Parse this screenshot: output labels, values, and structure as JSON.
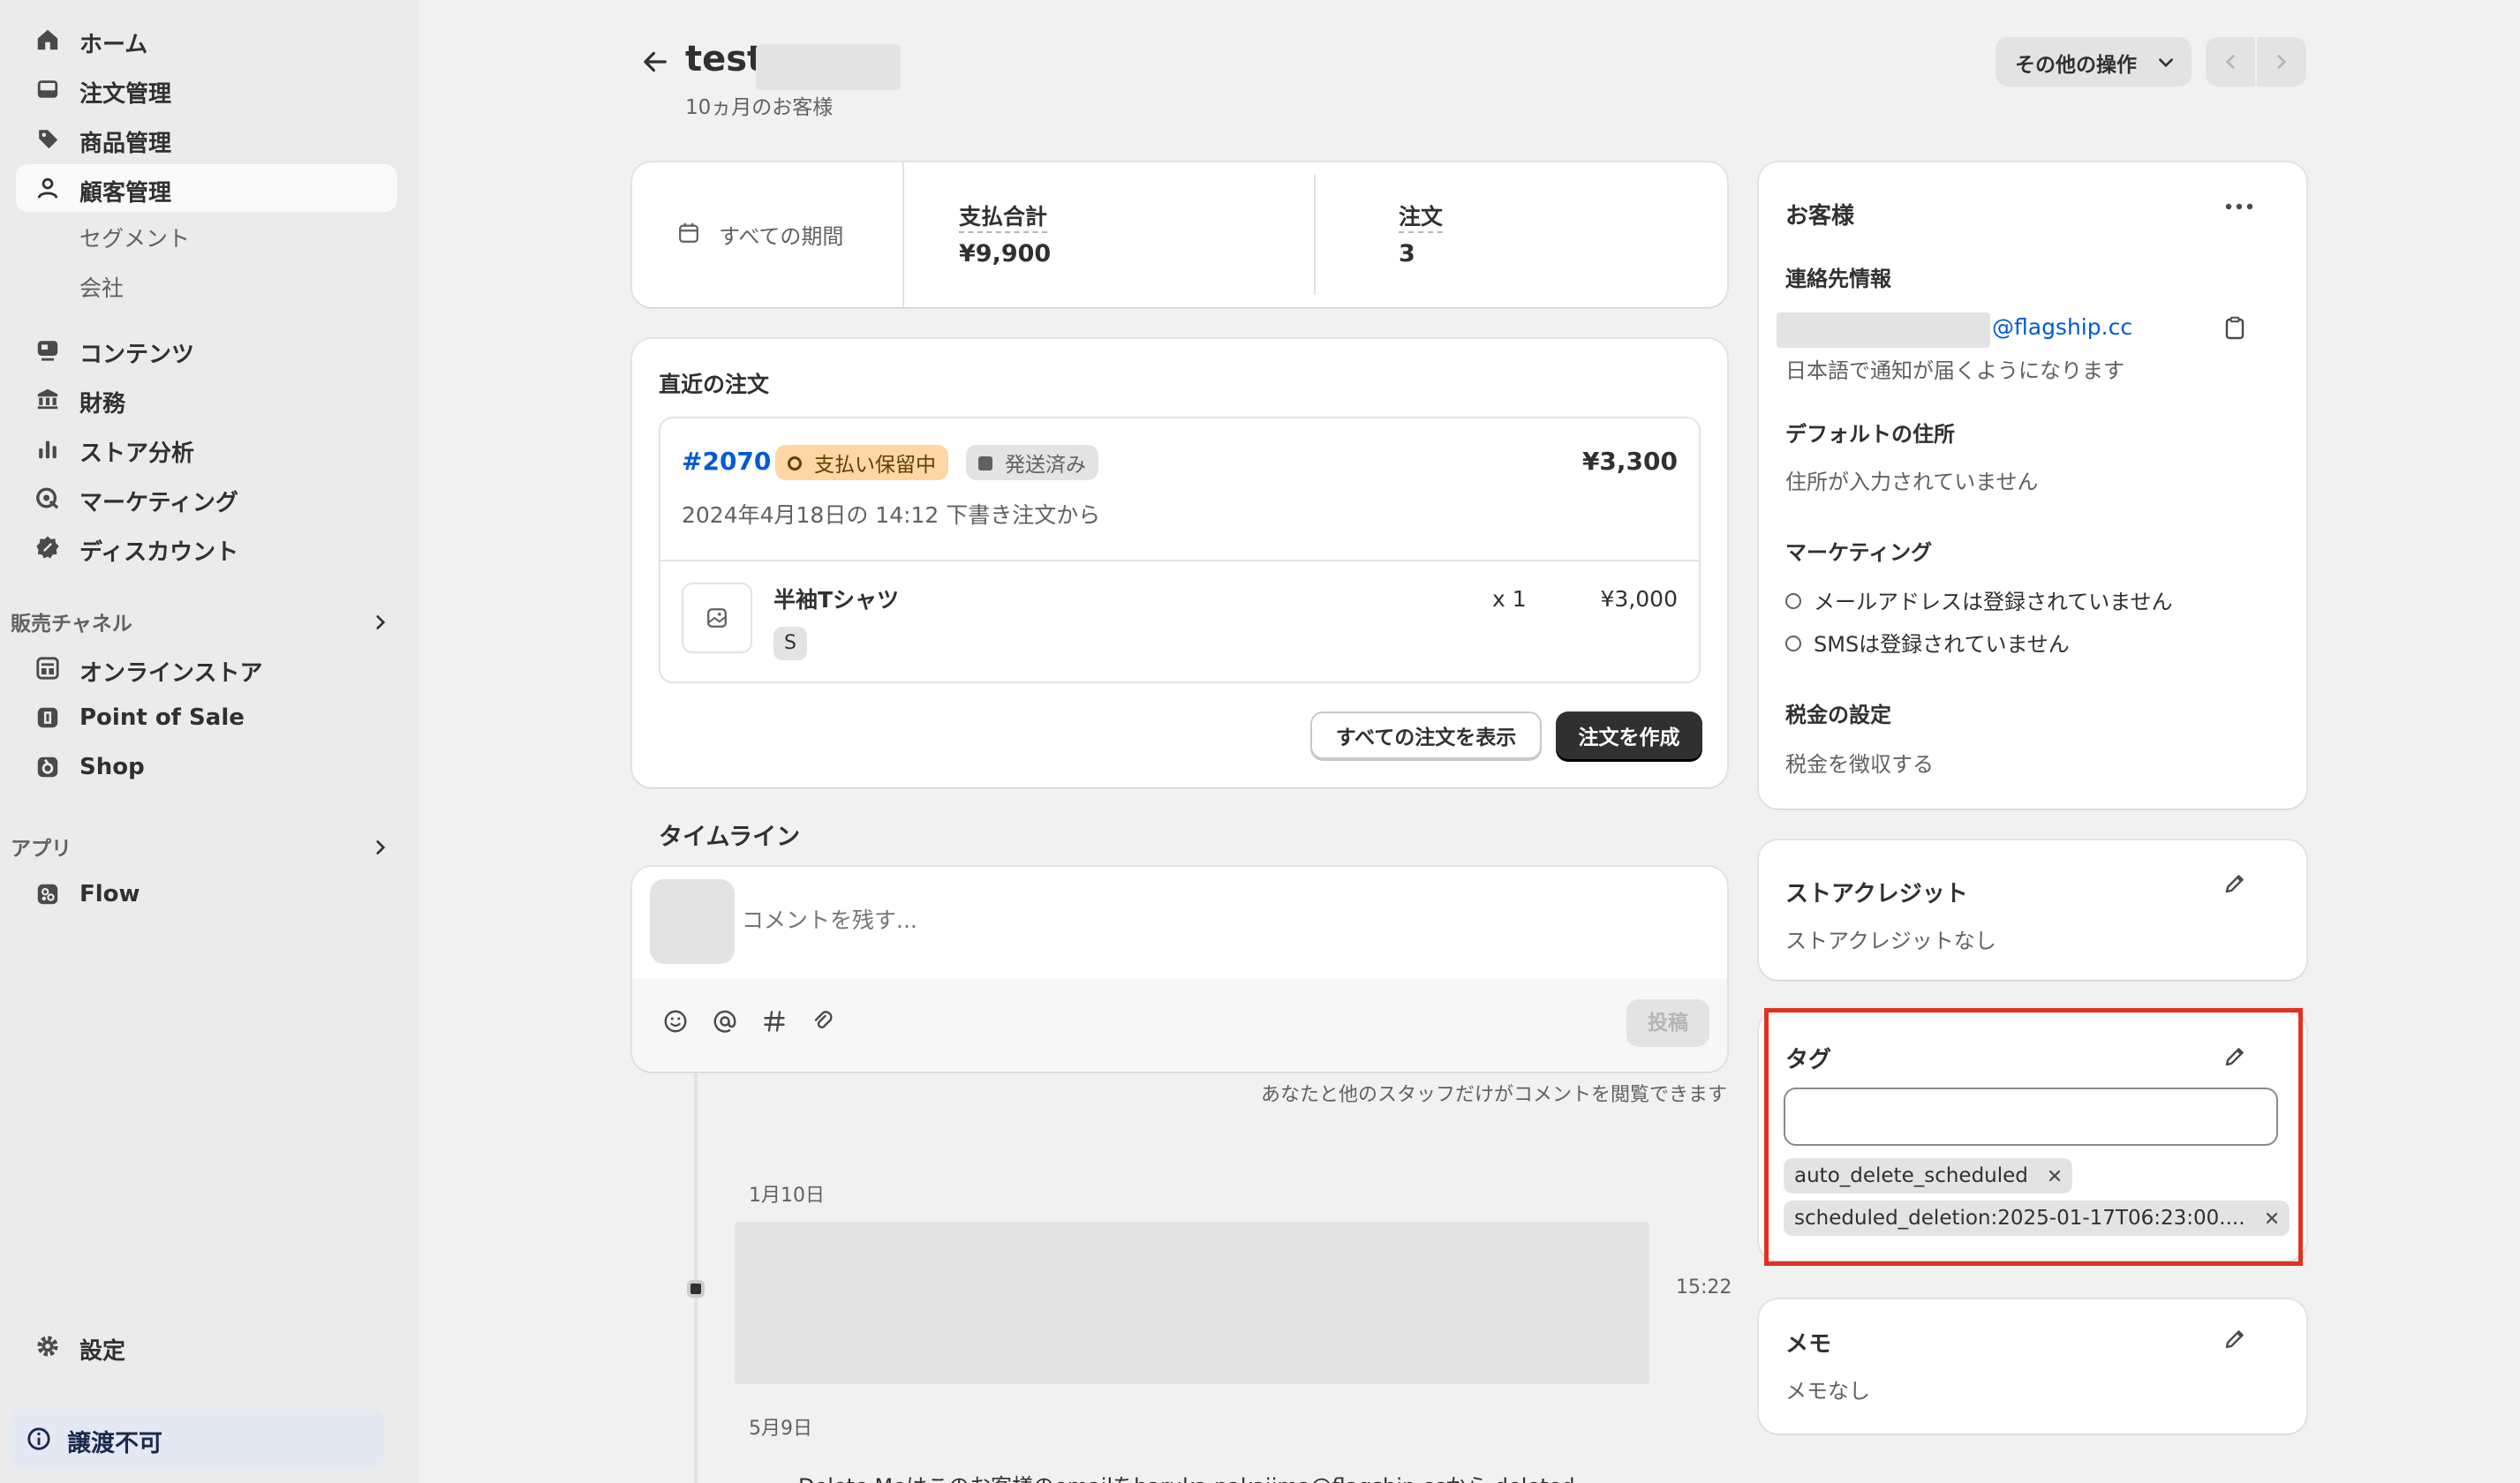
{
  "sidebar": {
    "items": [
      {
        "label": "ホーム",
        "icon": "home-icon"
      },
      {
        "label": "注文管理",
        "icon": "inbox-icon"
      },
      {
        "label": "商品管理",
        "icon": "tag-icon"
      },
      {
        "label": "顧客管理",
        "icon": "person-icon"
      },
      {
        "label": "コンテンツ",
        "icon": "content-icon"
      },
      {
        "label": "財務",
        "icon": "bank-icon"
      },
      {
        "label": "ストア分析",
        "icon": "bar-chart-icon"
      },
      {
        "label": "マーケティング",
        "icon": "target-icon"
      },
      {
        "label": "ディスカウント",
        "icon": "discount-icon"
      }
    ],
    "customer_subitems": [
      "セグメント",
      "会社"
    ],
    "sales_channels": {
      "label": "販売チャネル",
      "items": [
        {
          "label": "オンラインストア",
          "icon": "store-icon"
        },
        {
          "label": "Point of Sale",
          "icon": "pos-icon"
        },
        {
          "label": "Shop",
          "icon": "shop-icon"
        }
      ]
    },
    "apps": {
      "label": "アプリ",
      "items": [
        {
          "label": "Flow",
          "icon": "flow-icon"
        }
      ]
    },
    "settings_label": "設定",
    "banner_label": "譲渡不可"
  },
  "header": {
    "title": "test",
    "subtitle": "10ヵ月のお客様",
    "more_actions": "その他の操作"
  },
  "stats": {
    "period_label": "すべての期間",
    "total_label": "支払合計",
    "total_value": "¥9,900",
    "orders_label": "注文",
    "orders_value": "3"
  },
  "recent_orders": {
    "title": "直近の注文",
    "order_number": "#2070",
    "payment_badge": "支払い保留中",
    "fulfillment_badge": "発送済み",
    "order_total": "¥3,300",
    "order_meta": "2024年4月18日の 14:12 下書き注文から",
    "item_name": "半袖Tシャツ",
    "item_variant": "S",
    "item_qty": "x 1",
    "item_price": "¥3,000",
    "view_all_button": "すべての注文を表示",
    "create_order_button": "注文を作成"
  },
  "timeline": {
    "title": "タイムライン",
    "comment_placeholder": "コメントを残す...",
    "post_button": "投稿",
    "visibility_note": "あなたと他のスタッフだけがコメントを閲覧できます",
    "date1": "1月10日",
    "time1": "15:22",
    "date2": "5月9日",
    "event2_text": "Delete Meはこのお客様のemailをharuka.nakajima@flagship.ccから deleted"
  },
  "customer_card": {
    "title": "お客様",
    "contact_label": "連絡先情報",
    "email_domain": "@flagship.cc",
    "notification_language": "日本語で通知が届くようになります",
    "address_label": "デフォルトの住所",
    "address_value": "住所が入力されていません",
    "marketing_label": "マーケティング",
    "email_marketing": "メールアドレスは登録されていません",
    "sms_marketing": "SMSは登録されていません",
    "tax_label": "税金の設定",
    "tax_value": "税金を徴収する"
  },
  "store_credit": {
    "title": "ストアクレジット",
    "value": "ストアクレジットなし"
  },
  "tags": {
    "title": "タグ",
    "input_value": "",
    "items": [
      "auto_delete_scheduled",
      "scheduled_deletion:2025-01-17T06:23:00...."
    ]
  },
  "notes": {
    "title": "メモ",
    "value": "メモなし"
  },
  "colors": {
    "link": "#005bd3",
    "highlight_border": "#e0321c",
    "badge_attention_bg": "#ffd6a4",
    "badge_neutral_bg": "#e3e3e3"
  }
}
